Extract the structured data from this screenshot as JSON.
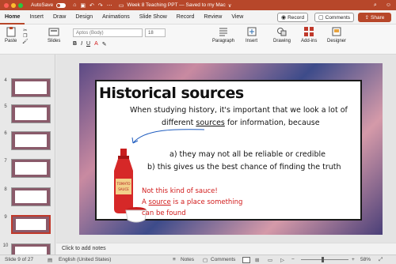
{
  "titlebar": {
    "autosave_label": "AutoSave",
    "autosave_state": "OFF",
    "doc_title": "Week 8 Teaching PPT — Saved to my Mac",
    "title_chevron": "∨"
  },
  "tabs": [
    "Home",
    "Insert",
    "Draw",
    "Design",
    "Animations",
    "Slide Show",
    "Record",
    "Review",
    "View"
  ],
  "actions": {
    "record": "Record",
    "comments": "Comments",
    "share": "Share"
  },
  "ribbon": {
    "paste_label": "Paste",
    "slides_label": "Slides",
    "font_name": "Aptos (Body)",
    "font_size": "18",
    "bold": "B",
    "italic": "I",
    "underline": "U",
    "paragraph_label": "Paragraph",
    "insert_label": "Insert",
    "drawing_label": "Drawing",
    "addins_label": "Add-ins",
    "designer_label": "Designer"
  },
  "thumbnails": [
    {
      "num": "4",
      "selected": false
    },
    {
      "num": "5",
      "selected": false
    },
    {
      "num": "6",
      "selected": false
    },
    {
      "num": "7",
      "selected": false
    },
    {
      "num": "8",
      "selected": false
    },
    {
      "num": "9",
      "selected": true
    },
    {
      "num": "10",
      "selected": false
    }
  ],
  "slide": {
    "title": "Historical sources",
    "line1": "When studying history, it's important that we look a lot of",
    "line2_a": "different ",
    "line2_b": "sources",
    "line2_c": " for information, because",
    "point_a": "a) they may not all be reliable or credible",
    "point_b": "b) this gives us the best chance of finding the truth",
    "bottle_label_1": "TOMATO",
    "bottle_label_2": "SAUCE",
    "note1": "Not this kind of sauce!",
    "note2_a": "A ",
    "note2_b": "source",
    "note2_c": " is a place something",
    "note3": "can be found"
  },
  "notes_placeholder": "Click to add notes",
  "status": {
    "slide_pos": "Slide 9 of 27",
    "language": "English (United States)",
    "notes": "Notes",
    "comments": "Comments",
    "zoom": "58%"
  },
  "colors": {
    "accent": "#b7472a",
    "slide_red": "#d11a1a"
  }
}
